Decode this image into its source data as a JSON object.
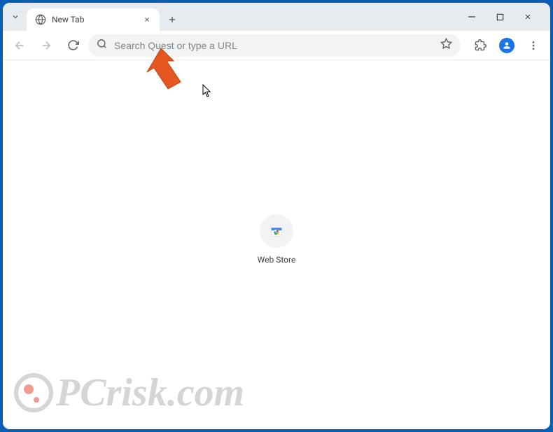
{
  "tab": {
    "title": "New Tab"
  },
  "omnibox": {
    "placeholder": "Search Quest or type a URL"
  },
  "shortcut": {
    "label": "Web Store"
  },
  "watermark": {
    "text": "PCrisk.com"
  }
}
